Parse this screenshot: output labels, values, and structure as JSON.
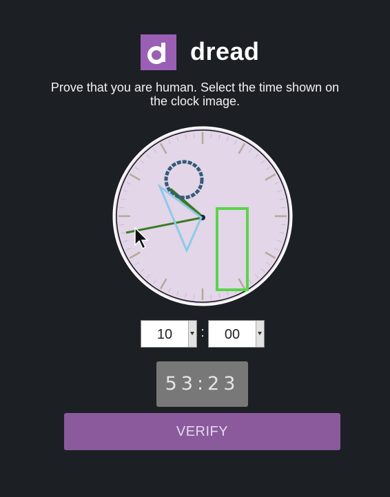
{
  "brand": {
    "logo_letter": "d",
    "name": "dread",
    "color": "#9a5fb4"
  },
  "captcha": {
    "instruction": "Prove that you are human. Select the time shown on the clock image.",
    "hours_value": "10",
    "separator": ":",
    "minutes_value": "00",
    "countdown": "53:23",
    "verify_label": "VERIFY"
  },
  "colors": {
    "background": "#1c1f24",
    "clock_face": "#e2d6e8",
    "verify_button": "#8a5a9c",
    "countdown_box": "#787878",
    "distractor_green": "#5bd44a",
    "distractor_blue": "#8ec9e8"
  },
  "icons": {
    "cursor": "mouse-pointer-icon",
    "select_arrow": "dropdown-arrow-icon"
  }
}
